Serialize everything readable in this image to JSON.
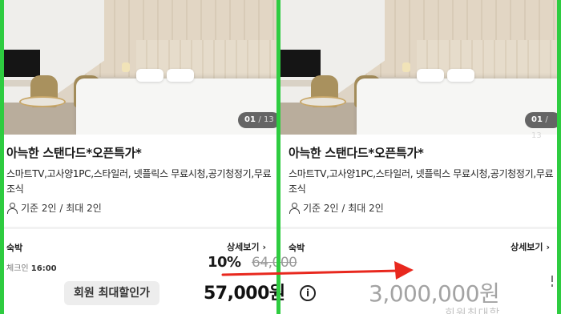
{
  "listing": {
    "photo_counter_current": "01",
    "photo_counter_total": "/ 13",
    "title": "아늑한 스탠다드*오픈특가*",
    "amenities": "스마트TV,고사양1PC,스타일러, 넷플릭스 무료시청,공기청정기,무료조식",
    "capacity": "기준 2인 / 최대 2인"
  },
  "booking": {
    "stay_label": "숙박",
    "detail_label": "상세보기",
    "checkin_label": "체크인",
    "checkin_time": "16:00"
  },
  "price_before": {
    "discount": "10%",
    "original_price": "64,000",
    "member_label": "회원 최대할인가",
    "final_price": "57,000원"
  },
  "price_after": {
    "price": "3,000,000원"
  },
  "colors": {
    "annotation_arrow": "#e8281e",
    "frame_border": "#2ecc40"
  }
}
